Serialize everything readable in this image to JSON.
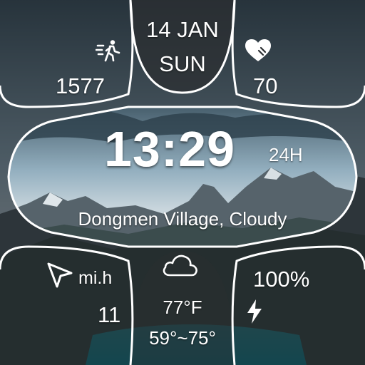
{
  "date": {
    "day": "14 JAN",
    "weekday": "SUN"
  },
  "steps": {
    "value": "1577",
    "icon": "walking-icon"
  },
  "heart_rate": {
    "value": "70",
    "icon": "heart-icon"
  },
  "time": {
    "display": "13:29",
    "format": "24H"
  },
  "location": {
    "text": "Dongmen Village, Cloudy"
  },
  "speed": {
    "value": "11",
    "unit": "mi.h",
    "icon": "navigation-arrow-icon"
  },
  "weather": {
    "icon": "cloud-icon",
    "current_temp": "77°F",
    "range": "59°~75°"
  },
  "battery": {
    "value": "100%",
    "icon": "lightning-bolt-icon"
  },
  "colors": {
    "text": "#ffffff",
    "dark_panel": "#2b2e31",
    "lake": "#1e8b91",
    "sky": "#9db8c8"
  }
}
